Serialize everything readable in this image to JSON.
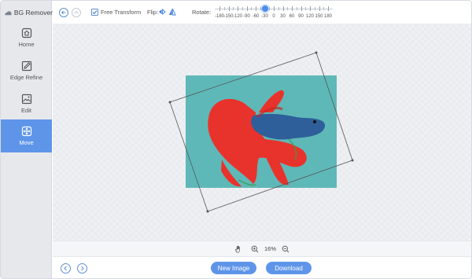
{
  "app": {
    "title": "BG Remover"
  },
  "sidebar": {
    "items": [
      {
        "label": "Home",
        "icon": "home-icon"
      },
      {
        "label": "Edge Refine",
        "icon": "pen-icon"
      },
      {
        "label": "Edit",
        "icon": "image-edit-icon"
      },
      {
        "label": "Move",
        "icon": "move-icon",
        "active": true
      }
    ]
  },
  "toolbar": {
    "free_transform_label": "Free Transform",
    "free_transform_checked": true,
    "flip_label": "Flip:",
    "rotate_label": "Rotate:",
    "rotate_ticks": [
      "-180",
      "-150",
      "-120",
      "-90",
      "-60",
      "-30",
      "0",
      "30",
      "60",
      "90",
      "120",
      "150",
      "180"
    ],
    "rotate_value": -30
  },
  "zoom": {
    "value": "16%"
  },
  "actions": {
    "new_image_label": "New Image",
    "download_label": "Download"
  },
  "colors": {
    "accent": "#5e95e9",
    "photo_background": "#5fb8b8",
    "fish_red": "#e8332c",
    "fish_blue": "#2e5f9a"
  }
}
